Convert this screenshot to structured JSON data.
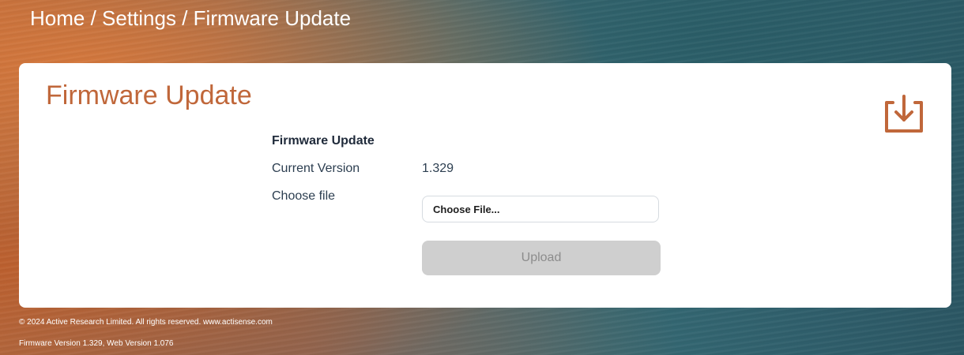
{
  "breadcrumb": {
    "home": "Home",
    "separator": " / ",
    "settings": "Settings",
    "current": "Firmware Update"
  },
  "panel": {
    "title": "Firmware Update",
    "icon": "download-tray-icon"
  },
  "form": {
    "heading": "Firmware Update",
    "current_version_label": "Current Version",
    "current_version_value": "1.329",
    "choose_file_label": "Choose file",
    "choose_file_button": "Choose File...",
    "upload_button": "Upload"
  },
  "footer": {
    "copyright": "© 2024 Active Research Limited. All rights reserved.  www.actisense.com",
    "versions": "Firmware Version 1.329, Web Version 1.076"
  },
  "colors": {
    "accent": "#c0673a",
    "panel_bg": "#ffffff",
    "button_disabled_bg": "#cfcfcf",
    "button_disabled_text": "#8c8c8c"
  }
}
